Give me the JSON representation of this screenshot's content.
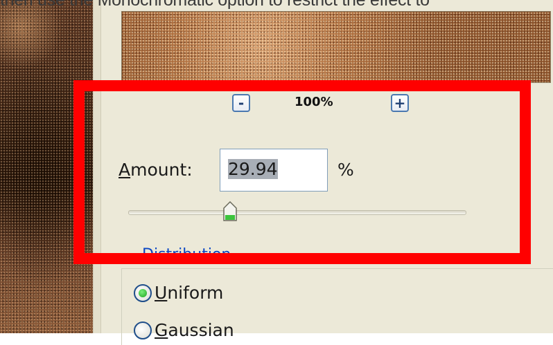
{
  "caption": {
    "text": "then use the Monochromatic option to restrict the effect to"
  },
  "zoom": {
    "minus_label": "-",
    "value": "100%",
    "plus_label": "+"
  },
  "amount": {
    "label_mnemonic": "A",
    "label_rest": "mount:",
    "value": "29.94",
    "unit": "%",
    "slider_percent": 29.94
  },
  "distribution": {
    "section_label": "Distribution",
    "options": [
      {
        "mnemonic": "U",
        "rest": "niform",
        "checked": true
      },
      {
        "mnemonic": "G",
        "rest": "aussian",
        "checked": false
      }
    ]
  },
  "highlight": {
    "color": "#ff0000"
  },
  "colors": {
    "dialog_bg": "#ece9d8",
    "accent_link": "#0b47c4",
    "radio_check": "#1ea31e",
    "selection_bg": "#a8aeb6"
  }
}
